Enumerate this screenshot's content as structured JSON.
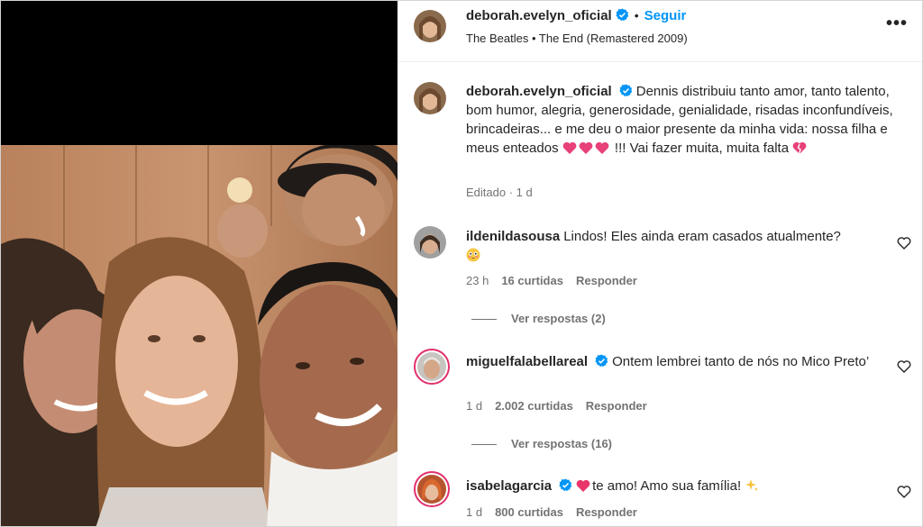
{
  "post": {
    "author": "deborah.evelyn_oficial",
    "follow_label": "Seguir",
    "separator": "•",
    "music": "The Beatles • The End (Remastered 2009)",
    "more_label": "•••"
  },
  "caption": {
    "author": "deborah.evelyn_oficial",
    "text_part1": "Dennis distribuiu tanto amor, tanto talento, bom humor, alegria, generosidade, genialidade, risadas inconfundíveis, brincadeiras... e me deu o maior presente da minha vida: nossa filha e meus enteados",
    "text_part2": "!!! Vai fazer muita, muita falta",
    "meta": "Editado · 1 d"
  },
  "comments": [
    {
      "author": "ildenildasousa",
      "verified": false,
      "text": "Lindos! Eles ainda eram casados atualmente?",
      "time": "23 h",
      "likes": "16 curtidas",
      "reply_label": "Responder",
      "view_replies": "Ver respostas (2)"
    },
    {
      "author": "miguelfalabellareal",
      "verified": true,
      "text": "Ontem lembrei tanto de nós no Mico Preto’",
      "time": "1 d",
      "likes": "2.002 curtidas",
      "reply_label": "Responder",
      "view_replies": "Ver respostas (16)"
    },
    {
      "author": "isabelagarcia",
      "verified": true,
      "text": "te amo! Amo sua família!",
      "time": "1 d",
      "likes": "800 curtidas",
      "reply_label": "Responder"
    }
  ],
  "colors": {
    "accent": "#0095f6",
    "verified": "#0095f6",
    "secondary_text": "#737373"
  },
  "icons": {
    "verified": "verified-badge-icon",
    "heart": "heart-outline-icon",
    "more": "more-options-icon",
    "hearts_emoji": "pink-heart-icon",
    "broken_heart": "broken-heart-icon",
    "flushed": "flushed-face-icon",
    "sparkles": "sparkles-icon"
  }
}
